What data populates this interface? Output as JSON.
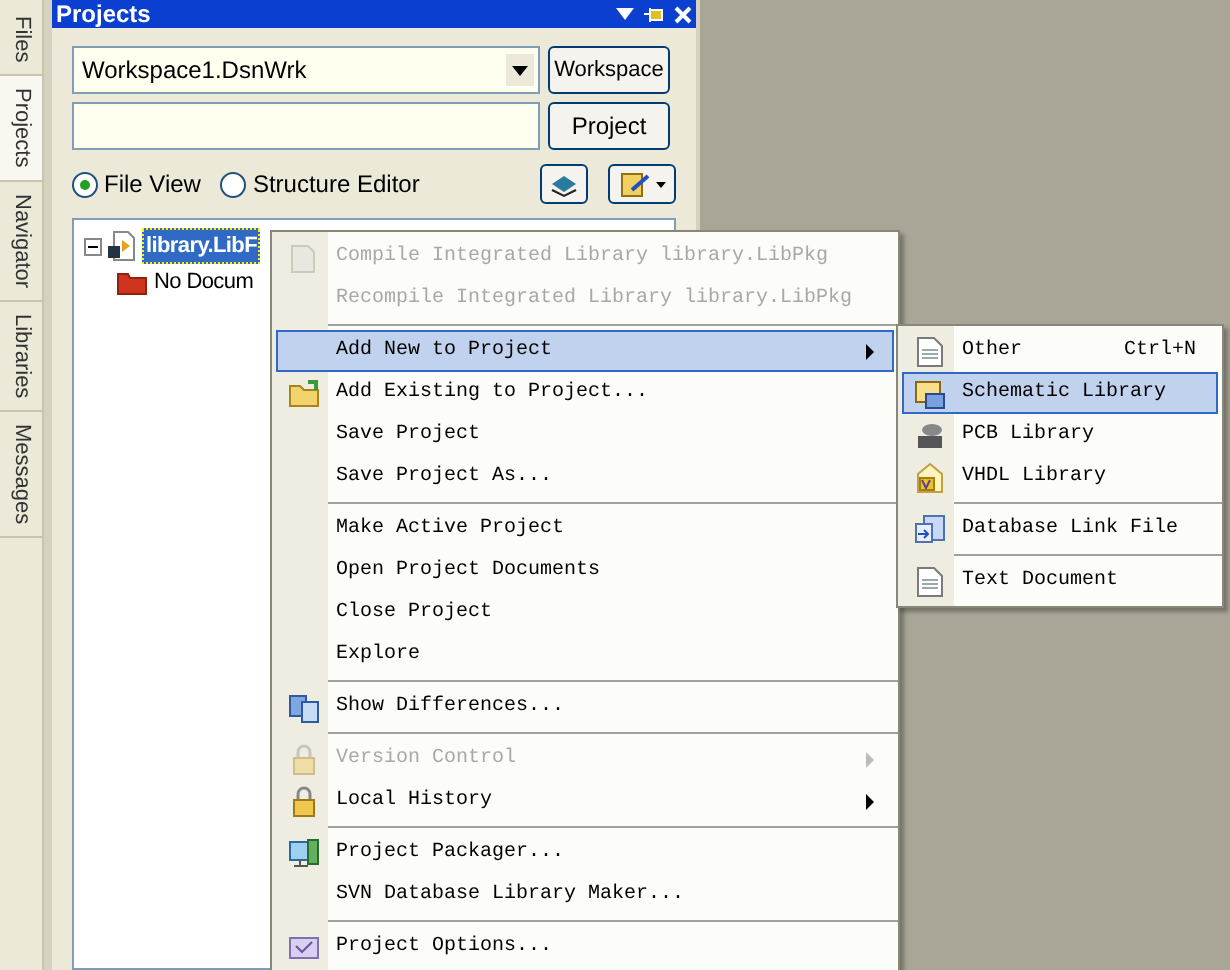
{
  "side_tabs": [
    {
      "label": "Files",
      "selected": false
    },
    {
      "label": "Projects",
      "selected": true
    },
    {
      "label": "Navigator",
      "selected": false
    },
    {
      "label": "Libraries",
      "selected": false
    },
    {
      "label": "Messages",
      "selected": false
    }
  ],
  "panel": {
    "title": "Projects",
    "workspace_combo": {
      "value": "Workspace1.DsnWrk"
    },
    "workspace_button": "Workspace",
    "project_button": "Project",
    "views": [
      {
        "label": "File View",
        "selected": true
      },
      {
        "label": "Structure Editor",
        "selected": false
      }
    ],
    "tree": [
      {
        "label": "library.LibF",
        "selected": true,
        "expanded": true,
        "children": [
          {
            "label": "No Docum",
            "selected": false
          }
        ]
      }
    ]
  },
  "context_menu": [
    {
      "kind": "item",
      "label": "Compile Integrated Library library.LibPkg",
      "disabled": true,
      "selected": false,
      "submenu": false
    },
    {
      "kind": "item",
      "label": "Recompile Integrated Library library.LibPkg",
      "disabled": true,
      "selected": false,
      "submenu": false
    },
    {
      "kind": "separator"
    },
    {
      "kind": "item",
      "label": "Add New to Project",
      "disabled": false,
      "selected": true,
      "submenu": true
    },
    {
      "kind": "item",
      "label": "Add Existing to Project...",
      "disabled": false,
      "selected": false,
      "submenu": false
    },
    {
      "kind": "item",
      "label": "Save Project",
      "disabled": false,
      "selected": false,
      "submenu": false
    },
    {
      "kind": "item",
      "label": "Save Project As...",
      "disabled": false,
      "selected": false,
      "submenu": false
    },
    {
      "kind": "separator"
    },
    {
      "kind": "item",
      "label": "Make Active Project",
      "disabled": false,
      "selected": false,
      "submenu": false
    },
    {
      "kind": "item",
      "label": "Open Project Documents",
      "disabled": false,
      "selected": false,
      "submenu": false
    },
    {
      "kind": "item",
      "label": "Close Project",
      "disabled": false,
      "selected": false,
      "submenu": false
    },
    {
      "kind": "item",
      "label": "Explore",
      "disabled": false,
      "selected": false,
      "submenu": false
    },
    {
      "kind": "separator"
    },
    {
      "kind": "item",
      "label": "Show Differences...",
      "disabled": false,
      "selected": false,
      "submenu": false
    },
    {
      "kind": "separator"
    },
    {
      "kind": "item",
      "label": "Version Control",
      "disabled": true,
      "selected": false,
      "submenu": true
    },
    {
      "kind": "item",
      "label": "Local History",
      "disabled": false,
      "selected": false,
      "submenu": true
    },
    {
      "kind": "separator"
    },
    {
      "kind": "item",
      "label": "Project Packager...",
      "disabled": false,
      "selected": false,
      "submenu": false
    },
    {
      "kind": "item",
      "label": "SVN Database Library Maker...",
      "disabled": false,
      "selected": false,
      "submenu": false
    },
    {
      "kind": "separator"
    },
    {
      "kind": "item",
      "label": "Project Options...",
      "disabled": false,
      "selected": false,
      "submenu": false
    }
  ],
  "submenu": [
    {
      "kind": "item",
      "label": "Other",
      "shortcut": "Ctrl+N",
      "selected": false
    },
    {
      "kind": "item",
      "label": "Schematic Library",
      "selected": true
    },
    {
      "kind": "item",
      "label": "PCB Library",
      "selected": false
    },
    {
      "kind": "item",
      "label": "VHDL Library",
      "selected": false
    },
    {
      "kind": "separator"
    },
    {
      "kind": "item",
      "label": "Database Link File",
      "selected": false
    },
    {
      "kind": "separator"
    },
    {
      "kind": "item",
      "label": "Text Document",
      "selected": false
    }
  ]
}
